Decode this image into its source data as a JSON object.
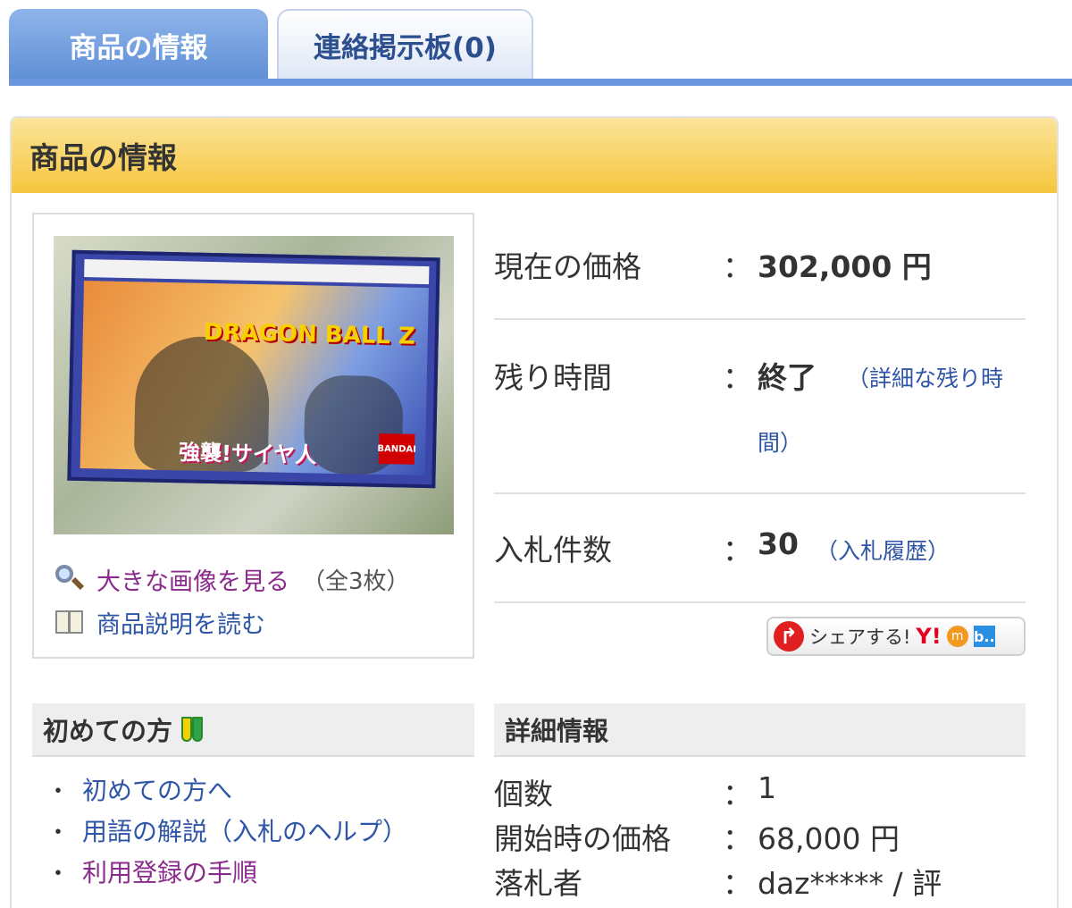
{
  "tabs": [
    {
      "label": "商品の情報",
      "active": true
    },
    {
      "label": "連絡掲示板(0)",
      "active": false
    }
  ],
  "section": {
    "title": "商品の情報"
  },
  "image_links": {
    "view_large": "大きな画像を見る",
    "count_note": "（全3枚）",
    "read_description": "商品説明を読む"
  },
  "info": {
    "price": {
      "label": "現在の価格",
      "colon": "：",
      "value": "302,000 円"
    },
    "time": {
      "label": "残り時間",
      "colon": "：",
      "value": "終了",
      "link_1": "（詳細な残り時",
      "link_2": "間）"
    },
    "bids": {
      "label": "入札件数",
      "colon": "：",
      "value": "30",
      "link": "（入札履歴）"
    }
  },
  "share": {
    "label": "シェアする!",
    "yahoo": "Y!",
    "m": "m",
    "h": "b.."
  },
  "beginner": {
    "title": "初めての方",
    "items": [
      "初めての方へ",
      "用語の解説（入札のヘルプ）",
      "利用登録の手順"
    ],
    "bullet": "・"
  },
  "detail": {
    "title": "詳細情報",
    "rows": [
      {
        "label": "個数",
        "colon": "：",
        "value": "1"
      },
      {
        "label": "開始時の価格",
        "colon": "：",
        "value": "68,000 円"
      },
      {
        "label": "落札者",
        "colon": "：",
        "value": "daz***** / 評"
      }
    ]
  },
  "product_image": {
    "logo_text": "DRAGON BALL Z",
    "title_text": "強襲!サイヤ人",
    "maker_text": "BANDAI"
  },
  "colors": {
    "tab_active": "#6b95dc",
    "header": "#f6c63d",
    "link_blue": "#2f56a6",
    "link_purple": "#8a2a8a"
  }
}
